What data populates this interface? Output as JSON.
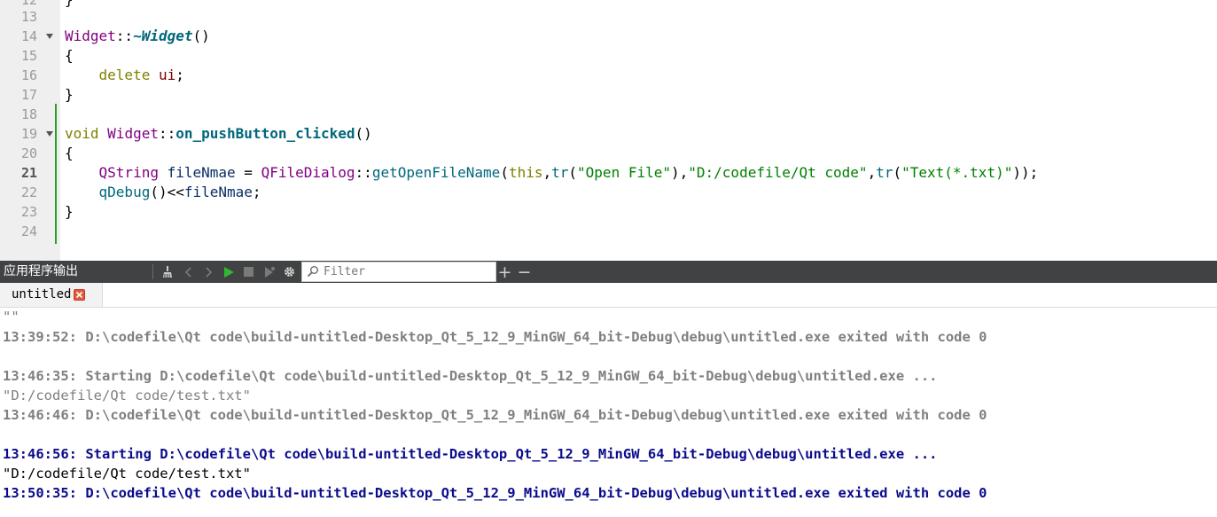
{
  "editor": {
    "line_numbers": [
      "12",
      "13",
      "14",
      "15",
      "16",
      "17",
      "18",
      "19",
      "20",
      "21",
      "22",
      "23",
      "24"
    ],
    "current_line": "21",
    "lines": {
      "l12_brace": "}",
      "l14_class": "Widget",
      "l14_sep": "::",
      "l14_dtor": "~Widget",
      "l14_parens": "()",
      "l15": "{",
      "l16_kw": "delete",
      "l16_var": "ui",
      "l16_semi": ";",
      "l17": "}",
      "l19_kw": "void",
      "l19_class": "Widget",
      "l19_sep": "::",
      "l19_fn": "on_pushButton_clicked",
      "l19_parens": "()",
      "l20": "{",
      "l21_type": "QString",
      "l21_var": "fileNmae",
      "l21_eq": " = ",
      "l21_class": "QFileDialog",
      "l21_sep": "::",
      "l21_fn": "getOpenFileName",
      "l21_p1": "(",
      "l21_this": "this",
      "l21_c1": ",",
      "l21_tr1": "tr",
      "l21_p2": "(",
      "l21_s1": "\"Open File\"",
      "l21_p3": "),",
      "l21_s2": "\"D:/codefile/Qt code\"",
      "l21_c2": ",",
      "l21_tr2": "tr",
      "l21_p4": "(",
      "l21_s3": "\"Text(*.txt)\"",
      "l21_p5": "));",
      "l22_fn": "qDebug",
      "l22_op": "()<<",
      "l22_var": "fileNmae",
      "l22_semi": ";",
      "l23": "}"
    }
  },
  "output_pane": {
    "title": "应用程序输出",
    "filter_placeholder": "Filter",
    "add_symbol": "+",
    "remove_symbol": "−",
    "tabs": [
      {
        "label": "untitled"
      }
    ],
    "lines": [
      {
        "text": "\"\"",
        "style": "gray"
      },
      {
        "text": "13:39:52: D:\\codefile\\Qt code\\build-untitled-Desktop_Qt_5_12_9_MinGW_64_bit-Debug\\debug\\untitled.exe exited with code 0",
        "style": "grayb"
      },
      {
        "text": "",
        "style": "gray"
      },
      {
        "text": "13:46:35: Starting D:\\codefile\\Qt code\\build-untitled-Desktop_Qt_5_12_9_MinGW_64_bit-Debug\\debug\\untitled.exe ...",
        "style": "grayb"
      },
      {
        "text": "\"D:/codefile/Qt code/test.txt\"",
        "style": "gray"
      },
      {
        "text": "13:46:46: D:\\codefile\\Qt code\\build-untitled-Desktop_Qt_5_12_9_MinGW_64_bit-Debug\\debug\\untitled.exe exited with code 0",
        "style": "grayb"
      },
      {
        "text": "",
        "style": "gray"
      },
      {
        "text": "13:46:56: Starting D:\\codefile\\Qt code\\build-untitled-Desktop_Qt_5_12_9_MinGW_64_bit-Debug\\debug\\untitled.exe ...",
        "style": "blueb"
      },
      {
        "text": "\"D:/codefile/Qt code/test.txt\"",
        "style": "black"
      },
      {
        "text": "13:50:35: D:\\codefile\\Qt code\\build-untitled-Desktop_Qt_5_12_9_MinGW_64_bit-Debug\\debug\\untitled.exe exited with code 0",
        "style": "blueb"
      }
    ]
  },
  "icons": {
    "toolbar": [
      "broom-icon",
      "chevron-left-icon",
      "chevron-right-icon",
      "run-icon",
      "stop-icon",
      "debug-run-icon",
      "gear-icon"
    ],
    "filter": "search-icon",
    "tab_close": "close-icon"
  },
  "colors": {
    "change_marker": "#2a9e2a",
    "keyword": "#808000",
    "type": "#800080",
    "function": "#00677c",
    "string": "#008000",
    "output_current": "#0b0b8c",
    "output_old": "#808080",
    "run_icon": "#2fb82f",
    "tab_close": "#e0593b"
  }
}
